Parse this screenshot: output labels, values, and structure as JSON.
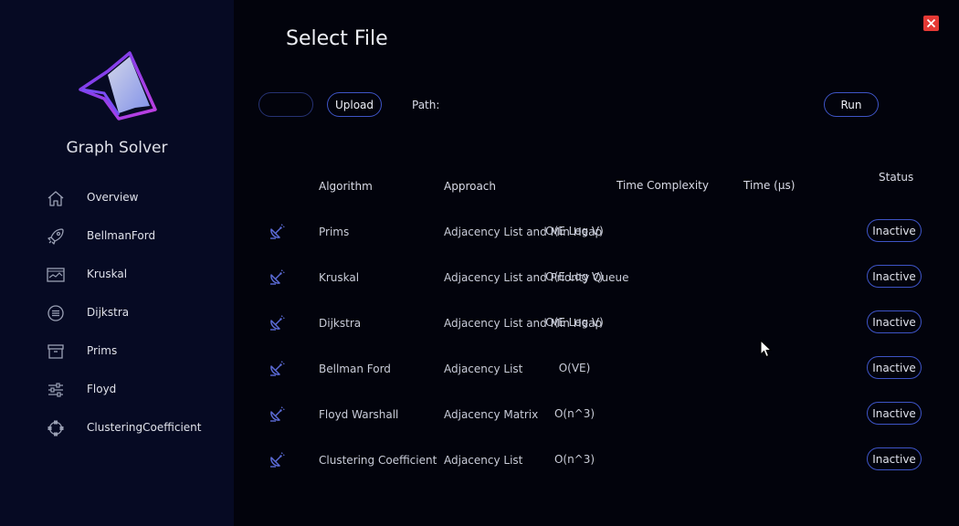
{
  "app": {
    "title": "Graph Solver"
  },
  "sidebar": {
    "items": [
      {
        "label": "Overview",
        "icon": "home-icon"
      },
      {
        "label": "BellmanFord",
        "icon": "rocket-icon"
      },
      {
        "label": "Kruskal",
        "icon": "chart-window-icon"
      },
      {
        "label": "Dijkstra",
        "icon": "list-circle-icon"
      },
      {
        "label": "Prims",
        "icon": "archive-icon"
      },
      {
        "label": "Floyd",
        "icon": "sliders-icon"
      },
      {
        "label": "ClusteringCoefficient",
        "icon": "network-icon"
      }
    ]
  },
  "main": {
    "title": "Select File",
    "file_value": "",
    "upload_label": "Upload",
    "path_label": "Path:",
    "run_label": "Run"
  },
  "table": {
    "headers": {
      "algorithm": "Algorithm",
      "approach": "Approach",
      "complexity": "Time Complexity",
      "time": "Time (µs)",
      "status": "Status"
    },
    "rows": [
      {
        "algorithm": "Prims",
        "approach": "Adjacency List and Min Heap",
        "complexity": "O(E Log V)",
        "time": "",
        "status": "Inactive"
      },
      {
        "algorithm": "Kruskal",
        "approach": "Adjacency List and Priority Queue",
        "complexity": "O(E Log V)",
        "time": "",
        "status": "Inactive"
      },
      {
        "algorithm": "Dijkstra",
        "approach": "Adjacency List and Min Heap",
        "complexity": "O(E Log V)",
        "time": "",
        "status": "Inactive"
      },
      {
        "algorithm": "Bellman Ford",
        "approach": "Adjacency List",
        "complexity": "O(VE)",
        "time": "",
        "status": "Inactive"
      },
      {
        "algorithm": "Floyd Warshall",
        "approach": "Adjacency Matrix",
        "complexity": "O(n^3)",
        "time": "",
        "status": "Inactive"
      },
      {
        "algorithm": "Clustering Coefficient",
        "approach": "Adjacency List",
        "complexity": "O(n^3)",
        "time": "",
        "status": "Inactive"
      }
    ]
  },
  "colors": {
    "background": "#02030c",
    "sidebar": "#060a23",
    "accent": "#3e54c6",
    "close": "#e53935"
  }
}
